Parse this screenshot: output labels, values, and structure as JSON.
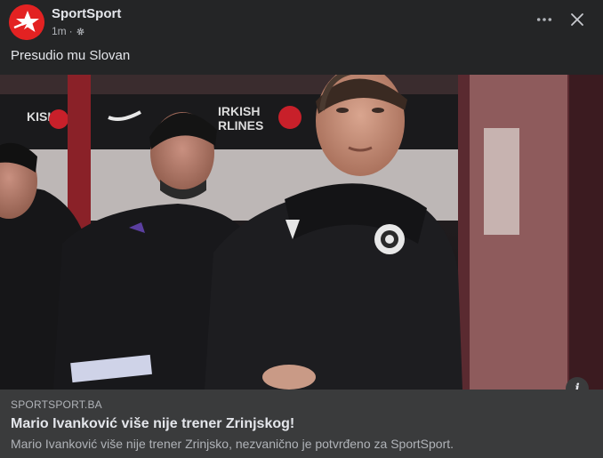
{
  "header": {
    "page_name": "SportSport",
    "time": "1m",
    "separator": "·",
    "privacy_icon": "gear-icon",
    "more_icon": "ellipsis-icon",
    "close_icon": "close-icon",
    "avatar_color": "#e32222"
  },
  "post": {
    "text": "Presudio mu Slovan"
  },
  "image": {
    "info_label": "i",
    "banner_text_1": "KISH",
    "banner_text_2": "IRKISH",
    "banner_text_3": "RLINES"
  },
  "link_preview": {
    "domain": "SPORTSPORT.BA",
    "title": "Mario Ivanković više nije trener Zrinjskog!",
    "description": "Mario Ivanković više nije trener Zrinjsko, nezvanično je potvrđeno za SportSport."
  }
}
